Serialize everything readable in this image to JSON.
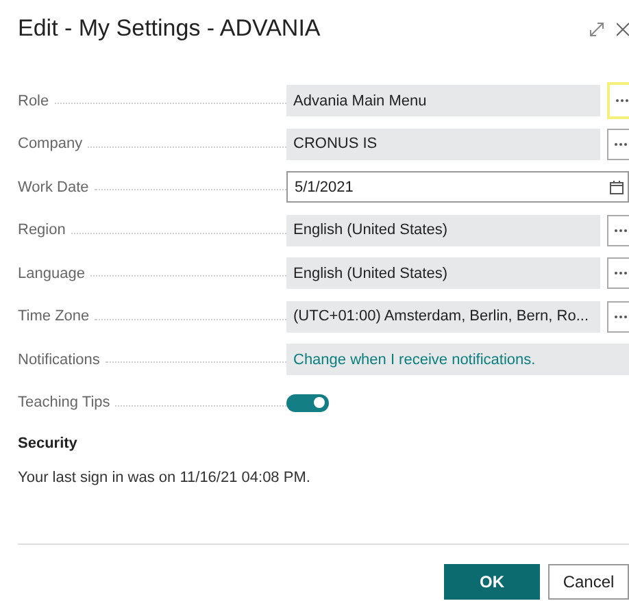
{
  "dialog": {
    "title": "Edit - My Settings - ADVANIA"
  },
  "fields": [
    {
      "label": "Role",
      "kind": "lookup",
      "value": "Advania Main Menu",
      "focused": true
    },
    {
      "label": "Company",
      "kind": "lookup",
      "value": "CRONUS IS",
      "focused": false
    },
    {
      "label": "Work Date",
      "kind": "date",
      "value": "5/1/2021"
    },
    {
      "label": "Region",
      "kind": "lookup",
      "value": "English (United States)",
      "focused": false
    },
    {
      "label": "Language",
      "kind": "lookup",
      "value": "English (United States)",
      "focused": false
    },
    {
      "label": "Time Zone",
      "kind": "lookup",
      "value": "(UTC+01:00) Amsterdam, Berlin, Bern, Ro...",
      "focused": false
    },
    {
      "label": "Notifications",
      "kind": "link",
      "value": "Change when I receive notifications."
    },
    {
      "label": "Teaching Tips",
      "kind": "toggle",
      "on": true
    }
  ],
  "security": {
    "heading": "Security",
    "text": "Your last sign in was on 11/16/21 04:08 PM."
  },
  "buttons": [
    {
      "label": "OK",
      "primary": true
    },
    {
      "label": "Cancel",
      "primary": false
    }
  ]
}
